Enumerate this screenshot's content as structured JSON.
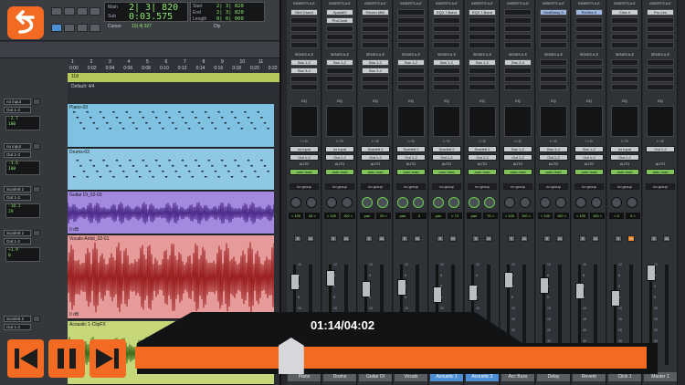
{
  "transport": {
    "main_label": "Main",
    "sub_label": "Sub",
    "main_counter": "2| 3| 820",
    "sub_counter": "0:03.575",
    "start_label": "Start",
    "end_label": "End",
    "length_label": "Length",
    "start_value": "2| 3| 820",
    "end_value": "2| 3| 820",
    "length_value": "0| 0| 000",
    "cursor_label": "Cursor",
    "cursor_value": "10| 4| 927",
    "dly_label": "Dly"
  },
  "ruler": {
    "bars": [
      "1",
      "2",
      "3",
      "4",
      "5",
      "6",
      "7",
      "8",
      "9",
      "10",
      "11"
    ],
    "times": [
      "0:00",
      "0:02",
      "0:04",
      "0:06",
      "0:08",
      "0:10",
      "0:12",
      "0:14",
      "0:16",
      "0:18",
      "0:20",
      "0:22"
    ],
    "tempo": "118",
    "meter": "Default: 4/4"
  },
  "edit_tracks": [
    {
      "name": "Piano-03",
      "color": "#7ec1e0",
      "input": "no input",
      "output": "Out 1-2",
      "vol": "-2.7",
      "pan": "100"
    },
    {
      "name": "Drums-03",
      "color": "#8fc8e4",
      "input": "no input",
      "output": "Out 1-2",
      "vol": "-3.6",
      "pan": "100"
    },
    {
      "name": "Guitar DI_02-03",
      "color": "#a38ae0",
      "input": "Scarlett 2",
      "output": "Out 1-2",
      "vol": "-10.2",
      "pan": "29"
    },
    {
      "name": "Vocals-Artist_02-01",
      "color": "#e79a9a",
      "input": "Scarlett 2",
      "output": "Out 1-2",
      "vol": "+1.9",
      "pan": "0"
    },
    {
      "name": "Acoustic 1-ClipFX",
      "color": "#c6d77a",
      "input": "Scarlett 2",
      "output": "Out 1-2",
      "vol": "",
      "pan": ""
    }
  ],
  "clip_gain_label": "0 dB",
  "mixer": {
    "inserts_header": "INSERTS A-E",
    "sends_header": "SENDS A-E",
    "eq_label": "EQ",
    "io_label": "I / O",
    "auto_label": "AUTO",
    "auto_read": "auto read",
    "no_group": "no group",
    "solo": "S",
    "mute": "M",
    "strips": [
      {
        "name": "Piano",
        "insert1": "Mini Grand",
        "insert2": "",
        "send1": "Bus 1-2",
        "send2": "Bus 3-4",
        "input": "no input",
        "output": "Out 1-2",
        "pan_l": "< 100",
        "pan_r": "44 >"
      },
      {
        "name": "Drums",
        "insert1": "Xpand!2",
        "insert2": "ProConst",
        "send1": "Bus 1-2",
        "send2": "",
        "input": "no input",
        "output": "Out 1-2",
        "pan_l": "< 100",
        "pan_r": "100 >"
      },
      {
        "name": "Guitar DI",
        "insert1": "Eleven MkII",
        "insert2": "",
        "send1": "Bus 1-2",
        "send2": "Bus 3-4",
        "input": "Scarlett 2",
        "output": "Out 1-2",
        "pan_l": "pan",
        "pan_r": "29 >"
      },
      {
        "name": "Vocals",
        "insert1": "",
        "insert2": "",
        "send1": "Bus 1-2",
        "send2": "",
        "input": "Scarlett 2",
        "output": "Out 1-2",
        "pan_l": "pan",
        "pan_r": "0"
      },
      {
        "name": "Acoustic 1",
        "insert1": "EQ3 7-Band",
        "insert2": "",
        "send1": "Bus 1-2",
        "send2": "",
        "input": "Scarlett 2",
        "output": "Out 1-2",
        "pan_l": "pan",
        "pan_r": "< 73"
      },
      {
        "name": "Acoustic 2",
        "insert1": "EQ3 7-Band",
        "insert2": "",
        "send1": "Bus 1-2",
        "send2": "",
        "input": "Scarlett 2",
        "output": "Out 1-2",
        "pan_l": "pan",
        "pan_r": "70 >"
      },
      {
        "name": "Acc Buss",
        "insert1": "",
        "insert2": "",
        "send1": "Bus 3-4",
        "send2": "",
        "input": "Bus 1-2",
        "output": "Out 1-2",
        "pan_l": "< 100",
        "pan_r": "100 >"
      },
      {
        "name": "Delay",
        "insert1": "ModDelay 3",
        "insert2": "",
        "send1": "",
        "send2": "",
        "input": "Bus 3-4",
        "output": "Out 1-2",
        "pan_l": "< 100",
        "pan_r": "100 >"
      },
      {
        "name": "Reverb",
        "insert1": "ReVibe II",
        "insert2": "",
        "send1": "",
        "send2": "",
        "input": "Bus 1-2",
        "output": "Out 1-2",
        "pan_l": "< 100",
        "pan_r": "100 >"
      },
      {
        "name": "Click 1",
        "insert1": "Click II",
        "insert2": "",
        "send1": "",
        "send2": "",
        "input": "no input",
        "output": "Out 1-2",
        "pan_l": "< 0",
        "pan_r": "0 >"
      },
      {
        "name": "Master 1",
        "insert1": "Pro Lim",
        "insert2": "",
        "send1": "",
        "send2": "",
        "input": "Out 1-2",
        "output": "",
        "pan_l": "",
        "pan_r": ""
      }
    ],
    "fader_scale": [
      "12",
      "6",
      "0",
      "5",
      "10",
      "15",
      "20",
      "30",
      "40"
    ]
  },
  "player": {
    "time": "01:14/04:02",
    "progress": 0.305,
    "back_icon": "back-arrow-icon",
    "accent": "#f36a22"
  }
}
